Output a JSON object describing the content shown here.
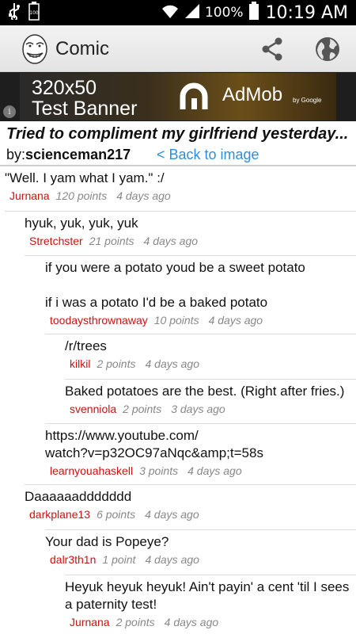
{
  "status_bar": {
    "battery_percent": "100%",
    "time": "10:19 AM",
    "icons": [
      "usb-icon",
      "battery-small-icon",
      "wifi-icon",
      "signal-icon",
      "battery-icon"
    ]
  },
  "action_bar": {
    "title": "Comic",
    "icons": [
      "rage-face-app-icon",
      "share-icon",
      "globe-icon"
    ]
  },
  "banner": {
    "line1": "320x50",
    "line2": "Test Banner",
    "brand": "AdMob",
    "brand_sub": "by Google",
    "info_glyph": "i"
  },
  "post": {
    "title": "Tried to compliment my girlfriend yesterday...",
    "by_prefix": "by:",
    "author": "scienceman217",
    "back_link": "< Back to image"
  },
  "comments": [
    {
      "body": "\"Well. I yam what I yam.\" :/",
      "user": "Jurnana",
      "points": "120 points",
      "age": "4 days ago",
      "depth": 0
    },
    {
      "body": "hyuk, yuk, yuk, yuk",
      "user": "Stretchster",
      "points": "21 points",
      "age": "4 days ago",
      "depth": 1
    },
    {
      "body": "if you were a potato youd be a sweet potato\n\nif i was a potato I'd be a baked potato",
      "user": "toodaysthrownaway",
      "points": "10 points",
      "age": "4 days ago",
      "depth": 2
    },
    {
      "body": "/r/trees",
      "user": "kilkil",
      "points": "2 points",
      "age": "4 days ago",
      "depth": 3
    },
    {
      "body": "Baked potatoes are the best. (Right after fries.)",
      "user": "svenniola",
      "points": "2 points",
      "age": "3 days ago",
      "depth": 3
    },
    {
      "body": "https://www.youtube.com/\nwatch?v=p32OC97aNqc&amp;t=58s",
      "user": "learnyouahaskell",
      "points": "3 points",
      "age": "4 days ago",
      "depth": 2
    },
    {
      "body": "Daaaaaaddddddd",
      "user": "darkplane13",
      "points": "6 points",
      "age": "4 days ago",
      "depth": 1
    },
    {
      "body": "Your dad is Popeye?",
      "user": "dalr3th1n",
      "points": "1 point",
      "age": "4 days ago",
      "depth": 2
    },
    {
      "body": "Heyuk heyuk heyuk! Ain't payin' a cent 'til I sees a paternity test!",
      "user": "Jurnana",
      "points": "2 points",
      "age": "4 days ago",
      "depth": 3
    }
  ]
}
